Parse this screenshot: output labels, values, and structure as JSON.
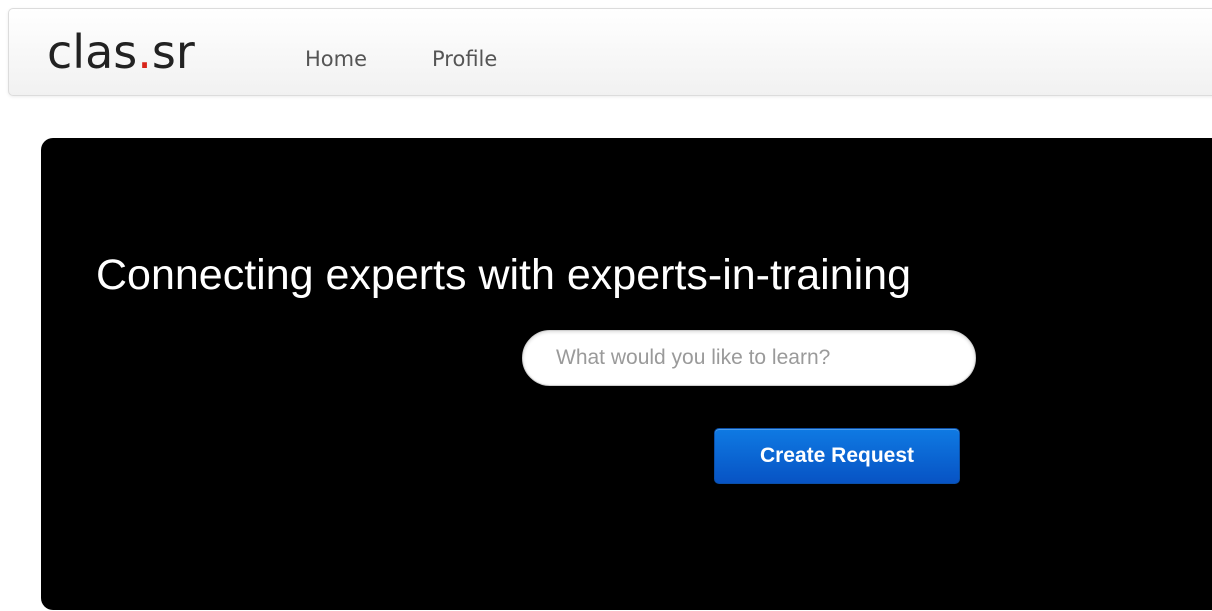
{
  "navbar": {
    "brand_prefix": "clas",
    "brand_dot": ".",
    "brand_suffix": "sr",
    "links": [
      {
        "label": "Home"
      },
      {
        "label": "Profile"
      }
    ]
  },
  "hero": {
    "title": "Connecting experts with experts-in-training",
    "search": {
      "placeholder": "What would you like to learn?",
      "value": ""
    },
    "create_button_label": "Create Request"
  },
  "colors": {
    "brand_dot": "#d8251a",
    "hero_background": "#000000",
    "button_blue": "#0a63d6"
  }
}
